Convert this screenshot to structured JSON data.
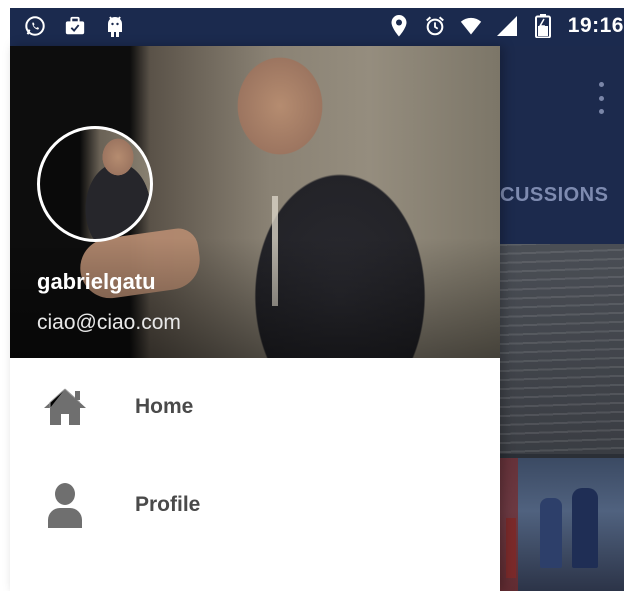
{
  "status_bar": {
    "time": "19:16",
    "left_icons": [
      "whatsapp-icon",
      "briefcase-icon",
      "android-icon"
    ],
    "right_icons": [
      "location-icon",
      "alarm-icon",
      "wifi-icon",
      "signal-icon",
      "battery-icon"
    ],
    "background_color": "#1b2a4e"
  },
  "drawer": {
    "header": {
      "username": "gabrielgatu",
      "email": "ciao@ciao.com"
    },
    "items": [
      {
        "label": "Home",
        "icon": "home-icon"
      },
      {
        "label": "Profile",
        "icon": "person-icon"
      }
    ]
  },
  "background_app": {
    "tab_label": "CUSSIONS",
    "toolbar_color": "#1c2a4d"
  },
  "colors": {
    "menu_icon": "#6f6f6f",
    "menu_text": "#4a4a4a"
  }
}
